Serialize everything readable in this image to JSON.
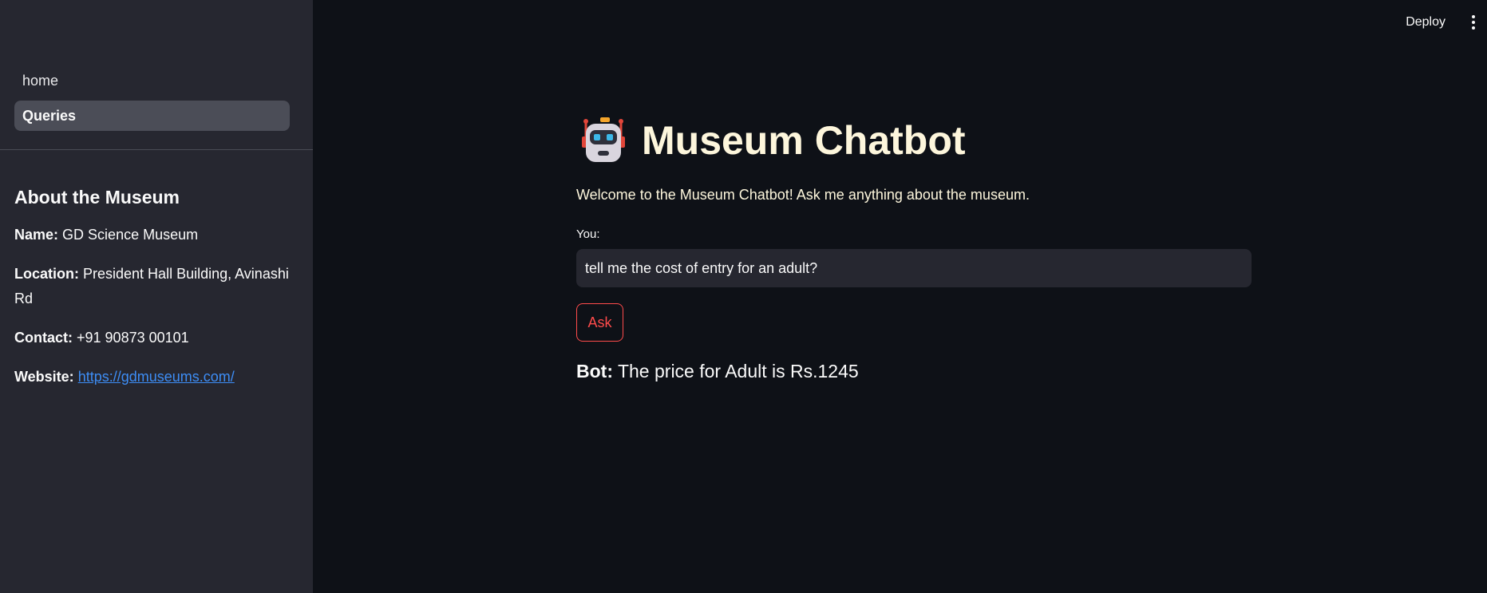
{
  "sidebar": {
    "nav": [
      {
        "label": "home",
        "active": false
      },
      {
        "label": "Queries",
        "active": true
      }
    ],
    "about": {
      "heading": "About the Museum",
      "name_label": "Name:",
      "name_value": "GD Science Museum",
      "location_label": "Location:",
      "location_value": "President Hall Building, Avinashi Rd",
      "contact_label": "Contact:",
      "contact_value": "+91 90873 00101",
      "website_label": "Website:",
      "website_value": "https://gdmuseums.com/"
    }
  },
  "topbar": {
    "deploy_label": "Deploy",
    "menu_icon": "kebab-menu-icon"
  },
  "main": {
    "title_icon": "robot-icon",
    "title": "Museum Chatbot",
    "welcome": "Welcome to the Museum Chatbot! Ask me anything about the museum.",
    "input_label": "You:",
    "input_value": "tell me the cost of entry for an adult?",
    "ask_label": "Ask",
    "bot_label": "Bot:",
    "bot_response": "The price for Adult is Rs.1245"
  },
  "colors": {
    "background": "#0e1117",
    "sidebar": "#262730",
    "accent": "#ff4b4b",
    "link": "#3d8df5",
    "title_text": "#fdf6dc"
  }
}
